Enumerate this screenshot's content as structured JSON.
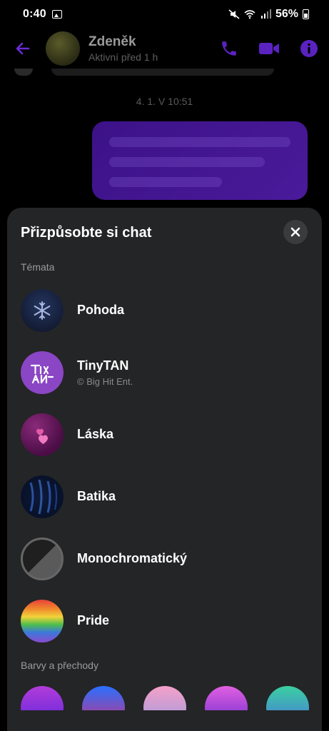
{
  "status_bar": {
    "time": "0:40",
    "battery": "56%"
  },
  "header": {
    "contact_name": "Zdeněk",
    "contact_status": "Aktivní před 1 h"
  },
  "chat": {
    "date_separator": "4. 1. V 10:51"
  },
  "sheet": {
    "title": "Přizpůsobte si chat",
    "themes_label": "Témata",
    "colors_label": "Barvy a přechody",
    "themes": [
      {
        "name": "Pohoda",
        "subtitle": ""
      },
      {
        "name": "TinyTAN",
        "subtitle": "© Big Hit Ent."
      },
      {
        "name": "Láska",
        "subtitle": ""
      },
      {
        "name": "Batika",
        "subtitle": ""
      },
      {
        "name": "Monochromatický",
        "subtitle": ""
      },
      {
        "name": "Pride",
        "subtitle": ""
      }
    ]
  },
  "colors": {
    "accent": "#7b2ff7",
    "sheet_bg": "#242526"
  }
}
